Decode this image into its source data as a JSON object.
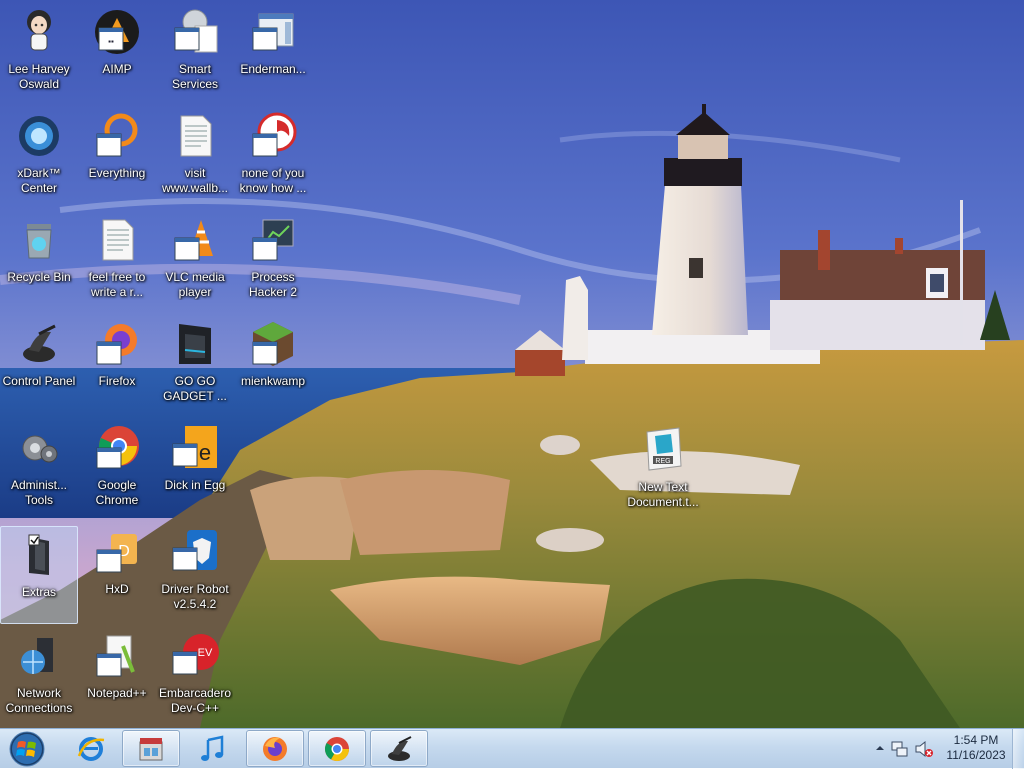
{
  "desktop": {
    "icons": [
      {
        "line1": "Lee Harvey",
        "line2": "Oswald",
        "icon": "anime-character-icon"
      },
      {
        "line1": "AIMP",
        "line2": "",
        "icon": "aimp-icon"
      },
      {
        "line1": "Smart",
        "line2": "Services",
        "icon": "smart-services-icon"
      },
      {
        "line1": "Enderman...",
        "line2": "",
        "icon": "enderman-icon"
      },
      {
        "line1": "xDark™",
        "line2": "Center",
        "icon": "xdark-center-icon"
      },
      {
        "line1": "Everything",
        "line2": "",
        "icon": "everything-icon"
      },
      {
        "line1": "visit",
        "line2": "www.wallb...",
        "icon": "text-document-icon"
      },
      {
        "line1": "none of you",
        "line2": "know how ...",
        "icon": "none-of-you-icon"
      },
      {
        "line1": "Recycle Bin",
        "line2": "",
        "icon": "recycle-bin-icon"
      },
      {
        "line1": "feel free to",
        "line2": "write a r...",
        "icon": "text-document-icon"
      },
      {
        "line1": "VLC media",
        "line2": "player",
        "icon": "vlc-icon"
      },
      {
        "line1": "Process",
        "line2": "Hacker 2",
        "icon": "process-hacker-icon"
      },
      {
        "line1": "Control Panel",
        "line2": "",
        "icon": "control-panel-icon"
      },
      {
        "line1": "Firefox",
        "line2": "",
        "icon": "firefox-icon"
      },
      {
        "line1": "GO GO",
        "line2": "GADGET ...",
        "icon": "gadget-icon"
      },
      {
        "line1": "mienkwamp",
        "line2": "",
        "icon": "minecraft-icon"
      },
      {
        "line1": "Administ...",
        "line2": "Tools",
        "icon": "admin-tools-icon"
      },
      {
        "line1": "Google",
        "line2": "Chrome",
        "icon": "chrome-icon"
      },
      {
        "line1": "Dick in Egg",
        "line2": "",
        "icon": "dick-in-egg-icon"
      },
      {
        "line1": "Extras",
        "line2": "",
        "icon": "extras-folder-icon"
      },
      {
        "line1": "HxD",
        "line2": "",
        "icon": "hxd-icon"
      },
      {
        "line1": "Driver Robot",
        "line2": "v2.5.4.2",
        "icon": "driver-robot-icon"
      },
      {
        "line1": "Network",
        "line2": "Connections",
        "icon": "network-connections-icon"
      },
      {
        "line1": "Notepad++",
        "line2": "",
        "icon": "notepad-plus-icon"
      },
      {
        "line1": "Embarcadero",
        "line2": "Dev-C++",
        "icon": "dev-cpp-icon"
      },
      {
        "line1": "New Text",
        "line2": "Document.t...",
        "icon": "reg-file-icon"
      }
    ]
  },
  "taskbar": {
    "start": {
      "icon": "windows-orb-icon"
    },
    "buttons": [
      {
        "icon": "internet-explorer-icon"
      },
      {
        "icon": "store-icon"
      },
      {
        "icon": "music-note-icon"
      },
      {
        "icon": "firefox-icon"
      },
      {
        "icon": "chrome-icon"
      },
      {
        "icon": "control-panel-icon"
      }
    ],
    "tray": {
      "time": "1:54 PM",
      "date": "11/16/2023",
      "icons": [
        "show-hidden-icons-arrow-icon",
        "network-tray-icon",
        "volume-muted-icon"
      ]
    }
  }
}
